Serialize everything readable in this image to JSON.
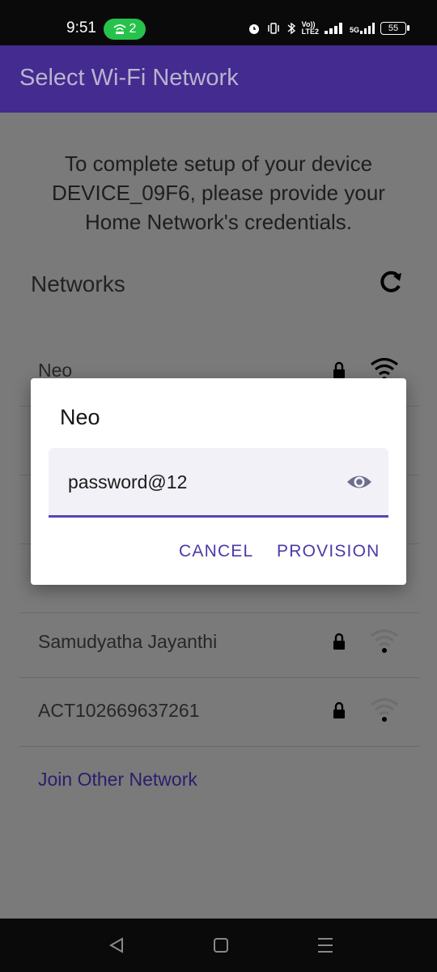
{
  "status_bar": {
    "time": "9:51",
    "hotspot_count": "2",
    "network_labels": [
      "Vo))",
      "LTE2"
    ],
    "signal_5g": "5G",
    "battery": "55"
  },
  "app_bar": {
    "title": "Select Wi-Fi Network"
  },
  "intro_text": "To complete setup of your device DEVICE_09F6, please provide your Home Network's credentials.",
  "networks_label": "Networks",
  "networks": [
    {
      "name": "Neo",
      "secured": true,
      "signal": "strong"
    },
    {
      "name": "Samudyatha Jayanthi",
      "secured": true,
      "signal": "weak"
    },
    {
      "name": "ACT102669637261",
      "secured": true,
      "signal": "weak"
    }
  ],
  "join_other": "Join Other Network",
  "dialog": {
    "title": "Neo",
    "password_value": "password@12",
    "cancel_label": "CANCEL",
    "provision_label": "PROVISION"
  },
  "colors": {
    "app_bar": "#432b8f",
    "accent": "#5b45b0",
    "hotspot": "#27c24c"
  },
  "icons": [
    "refresh-icon",
    "lock-icon",
    "wifi-icon",
    "eye-icon",
    "back-icon",
    "home-icon",
    "menu-icon"
  ]
}
